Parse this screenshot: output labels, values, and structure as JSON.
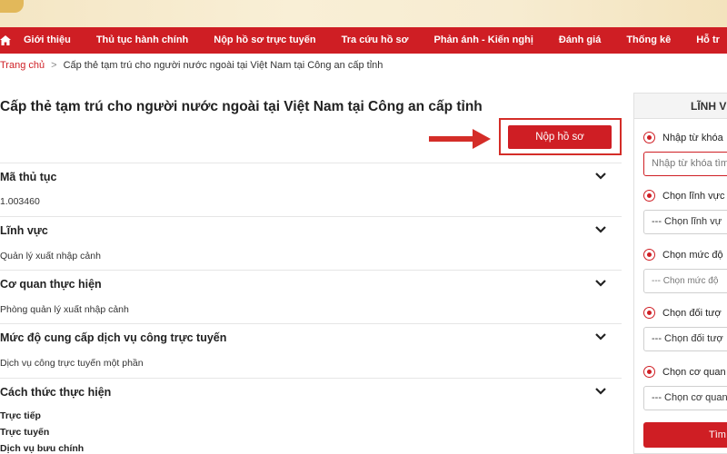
{
  "nav": {
    "items": [
      "Giới thiệu",
      "Thủ tục hành chính",
      "Nộp hồ sơ trực tuyến",
      "Tra cứu hồ sơ",
      "Phản ánh - Kiến nghị",
      "Đánh giá",
      "Thống kê",
      "Hỗ tr"
    ]
  },
  "breadcrumb": {
    "home": "Trang chủ",
    "separator": ">",
    "current": "Cấp thẻ tạm trú cho người nước ngoài tại Việt Nam tại Công an cấp tỉnh"
  },
  "page": {
    "title": "Cấp thẻ tạm trú cho người nước ngoài tại Việt Nam tại Công an cấp tỉnh",
    "submit_label": "Nộp hồ sơ"
  },
  "sections": [
    {
      "title": "Mã thủ tục",
      "values": [
        "1.003460"
      ]
    },
    {
      "title": "Lĩnh vực",
      "values": [
        "Quản lý xuất nhập cảnh"
      ]
    },
    {
      "title": "Cơ quan thực hiện",
      "values": [
        "Phòng quản lý xuất nhập cảnh"
      ]
    },
    {
      "title": "Mức độ cung cấp dịch vụ công trực tuyến",
      "values": [
        "Dịch vụ công trực tuyến một phần"
      ]
    },
    {
      "title": "Cách thức thực hiện",
      "values": [
        "Trực tiếp",
        "Trực tuyến",
        "Dịch vụ bưu chính"
      ]
    }
  ],
  "sidebar": {
    "title": "LĨNH VỰ",
    "keyword_label": "Nhập từ khóa",
    "keyword_placeholder": "Nhập từ khóa tìm",
    "field_label": "Chọn lĩnh vực",
    "field_value": "--- Chọn lĩnh vự",
    "level_label": "Chọn mức độ",
    "level_value": "--- Chọn mức độ",
    "target_label": "Chọn đối tượ",
    "target_value": "--- Chọn đối tượ",
    "agency_label": "Chọn cơ quan",
    "agency_value": "--- Chọn cơ quan",
    "search_label": "Tìm"
  },
  "colors": {
    "brand_red": "#cf1e24",
    "annotation_red": "#d42d28"
  },
  "icons": {
    "home": "home-icon",
    "expand": "chevron-down-icon",
    "annotation": "arrow-right-icon"
  }
}
